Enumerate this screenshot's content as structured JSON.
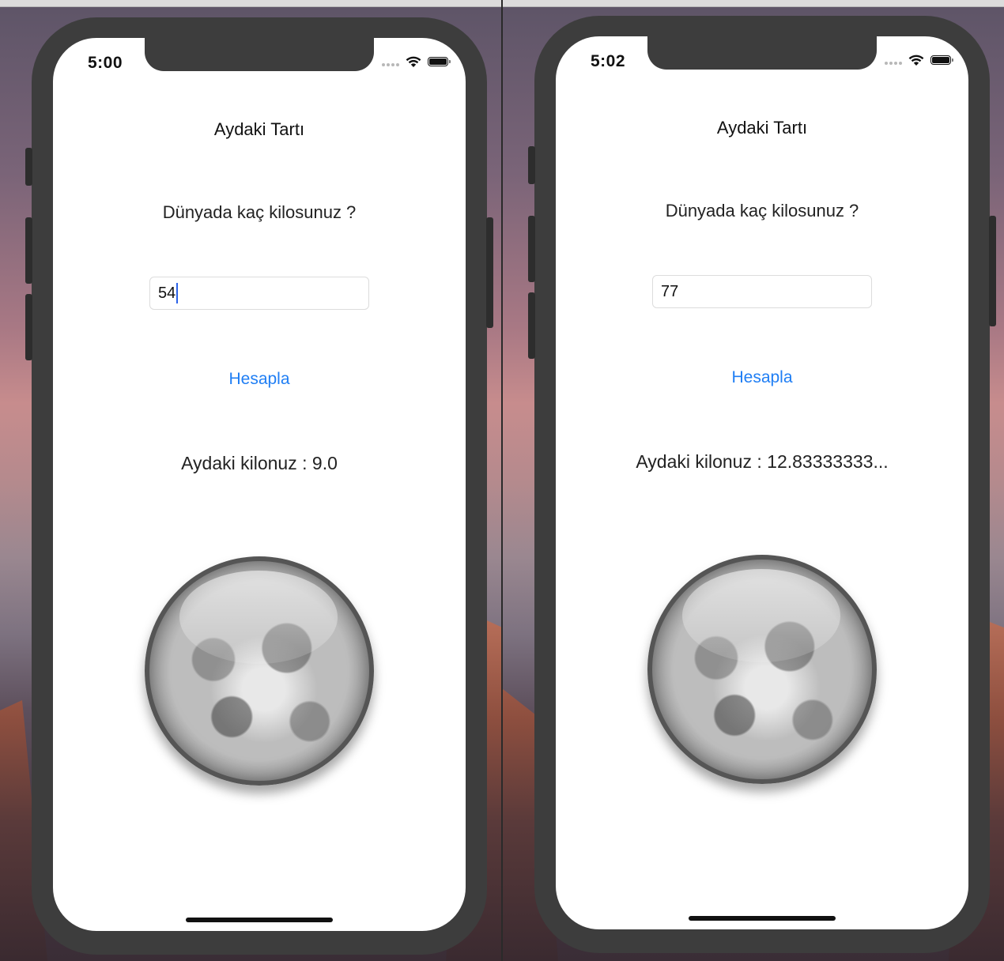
{
  "app": {
    "title": "Aydaki Tartı",
    "question": "Dünyada kaç kilosunuz ?",
    "button_label": "Hesapla",
    "colors": {
      "accent": "#1f7ef4",
      "text": "#222222",
      "phone_frame": "#3d3d3d"
    }
  },
  "screens": [
    {
      "status_time": "5:00",
      "input_value": "54",
      "input_focused": true,
      "result_text": "Aydaki kilonuz : 9.0"
    },
    {
      "status_time": "5:02",
      "input_value": "77",
      "input_focused": false,
      "result_text": "Aydaki kilonuz : 12.83333333..."
    }
  ],
  "icons": {
    "wifi": "wifi-icon",
    "battery": "battery-icon",
    "signal": "cellular-signal-icon",
    "moon": "moon-image"
  }
}
